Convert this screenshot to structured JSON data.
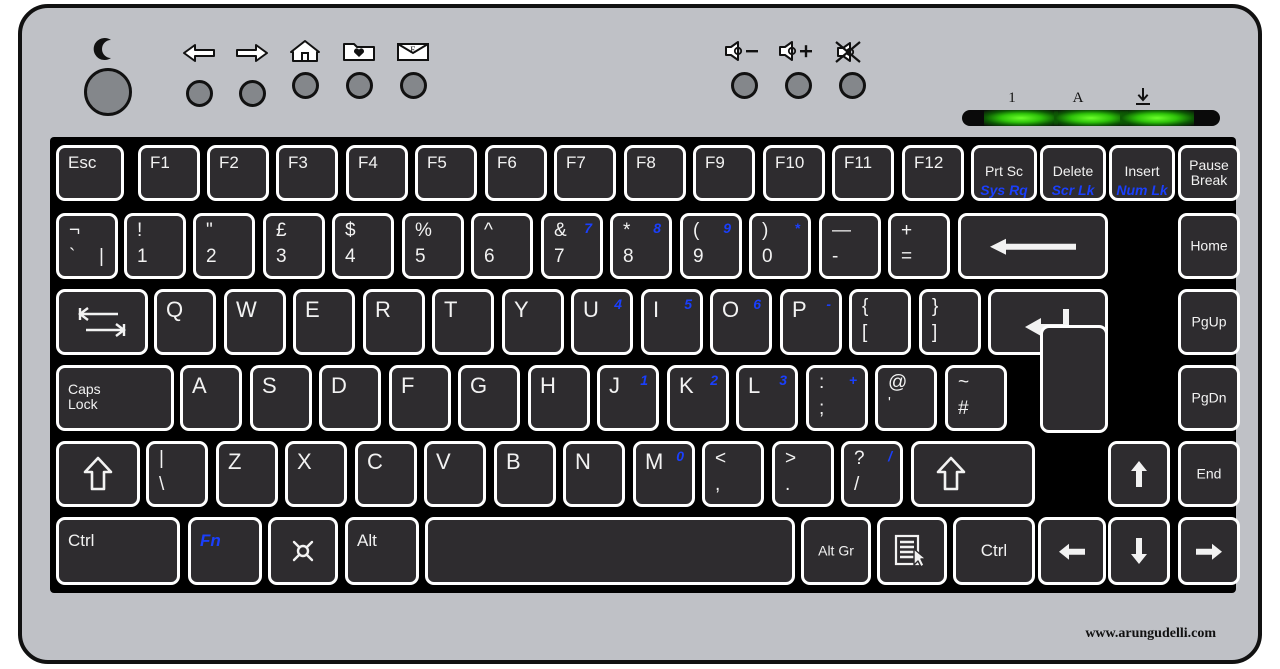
{
  "device": {
    "name": "Computer Keyboard Diagram",
    "layout": "UK QWERTY",
    "body_color": "#bfc1c6",
    "key_color": "#2e2c2f",
    "legend_color": "#f2f2f2",
    "alt_legend_color": "#1a3ffb"
  },
  "watermark": {
    "text": "www.arungudelli.com"
  },
  "hotkeys": {
    "left": [
      {
        "name": "sleep",
        "glyph": "moon",
        "size": "large"
      }
    ],
    "media": [
      {
        "name": "back",
        "glyph": "arrow-left"
      },
      {
        "name": "forward",
        "glyph": "arrow-right"
      },
      {
        "name": "home",
        "glyph": "house"
      },
      {
        "name": "favorites",
        "glyph": "folder-heart"
      },
      {
        "name": "email",
        "glyph": "envelope-e"
      }
    ],
    "volume": [
      {
        "name": "volume-down",
        "glyph": "speaker-minus"
      },
      {
        "name": "volume-up",
        "glyph": "speaker-plus"
      },
      {
        "name": "mute",
        "glyph": "speaker-mute"
      }
    ]
  },
  "indicators": [
    {
      "name": "num-lock",
      "label": "1",
      "lit": true,
      "color": "#2fc40a"
    },
    {
      "name": "caps-lock",
      "label": "A",
      "lit": true,
      "color": "#2fc40a"
    },
    {
      "name": "scroll-lock",
      "label": "scroll-lock-glyph",
      "lit": true,
      "color": "#2fc40a"
    }
  ],
  "rows": {
    "function": [
      {
        "name": "escape",
        "label": "Esc"
      },
      {
        "name": "f1",
        "label": "F1"
      },
      {
        "name": "f2",
        "label": "F2"
      },
      {
        "name": "f3",
        "label": "F3"
      },
      {
        "name": "f4",
        "label": "F4"
      },
      {
        "name": "f5",
        "label": "F5"
      },
      {
        "name": "f6",
        "label": "F6"
      },
      {
        "name": "f7",
        "label": "F7"
      },
      {
        "name": "f8",
        "label": "F8"
      },
      {
        "name": "f9",
        "label": "F9"
      },
      {
        "name": "f10",
        "label": "F10"
      },
      {
        "name": "f11",
        "label": "F11"
      },
      {
        "name": "f12",
        "label": "F12"
      },
      {
        "name": "print-screen",
        "label": "Prt Sc",
        "alt": "Sys Rq"
      },
      {
        "name": "delete",
        "label": "Delete",
        "alt": "Scr Lk"
      },
      {
        "name": "insert",
        "label": "Insert",
        "alt": "Num Lk"
      },
      {
        "name": "pause-break",
        "label": "Pause\nBreak"
      }
    ],
    "number": [
      {
        "name": "backtick",
        "top": "¬",
        "bottom": "`",
        "extra": "|"
      },
      {
        "name": "digit-1",
        "top": "!",
        "bottom": "1"
      },
      {
        "name": "digit-2",
        "top": "\"",
        "bottom": "2"
      },
      {
        "name": "digit-3",
        "top": "£",
        "bottom": "3"
      },
      {
        "name": "digit-4",
        "top": "$",
        "bottom": "4"
      },
      {
        "name": "digit-5",
        "top": "%",
        "bottom": "5"
      },
      {
        "name": "digit-6",
        "top": "^",
        "bottom": "6"
      },
      {
        "name": "digit-7",
        "top": "&",
        "bottom": "7",
        "alt": "7"
      },
      {
        "name": "digit-8",
        "top": "*",
        "bottom": "8",
        "alt": "8"
      },
      {
        "name": "digit-9",
        "top": "(",
        "bottom": "9",
        "alt": "9"
      },
      {
        "name": "digit-0",
        "top": ")",
        "bottom": "0",
        "alt": "*"
      },
      {
        "name": "minus",
        "top": "—",
        "bottom": "-"
      },
      {
        "name": "equals",
        "top": "+",
        "bottom": "="
      },
      {
        "name": "backspace",
        "label": "backspace-arrow"
      },
      {
        "name": "home",
        "label": "Home"
      }
    ],
    "top_letters": [
      {
        "name": "tab",
        "label": "tab-arrows"
      },
      {
        "name": "q",
        "label": "Q"
      },
      {
        "name": "w",
        "label": "W"
      },
      {
        "name": "e",
        "label": "E"
      },
      {
        "name": "r",
        "label": "R"
      },
      {
        "name": "t",
        "label": "T"
      },
      {
        "name": "y",
        "label": "Y"
      },
      {
        "name": "u",
        "label": "U",
        "alt": "4"
      },
      {
        "name": "i",
        "label": "I",
        "alt": "5"
      },
      {
        "name": "o",
        "label": "O",
        "alt": "6"
      },
      {
        "name": "p",
        "label": "P",
        "alt": "-"
      },
      {
        "name": "bracket-left",
        "top": "{",
        "bottom": "["
      },
      {
        "name": "bracket-right",
        "top": "}",
        "bottom": "]"
      },
      {
        "name": "enter",
        "label": "enter-arrow"
      },
      {
        "name": "page-up",
        "label": "PgUp"
      }
    ],
    "home_letters": [
      {
        "name": "caps-lock",
        "label": "Caps\nLock"
      },
      {
        "name": "a",
        "label": "A"
      },
      {
        "name": "s",
        "label": "S"
      },
      {
        "name": "d",
        "label": "D"
      },
      {
        "name": "f",
        "label": "F"
      },
      {
        "name": "g",
        "label": "G"
      },
      {
        "name": "h",
        "label": "H"
      },
      {
        "name": "j",
        "label": "J",
        "alt": "1"
      },
      {
        "name": "k",
        "label": "K",
        "alt": "2"
      },
      {
        "name": "l",
        "label": "L",
        "alt": "3"
      },
      {
        "name": "semicolon",
        "top": ":",
        "bottom": ";",
        "alt": "+"
      },
      {
        "name": "apostrophe",
        "top": "@",
        "bottom": "'"
      },
      {
        "name": "hash",
        "top": "~",
        "bottom": "#"
      },
      {
        "name": "page-down",
        "label": "PgDn"
      }
    ],
    "bottom_letters": [
      {
        "name": "shift-left",
        "label": "shift-arrow"
      },
      {
        "name": "backslash",
        "top": "|",
        "bottom": "\\"
      },
      {
        "name": "z",
        "label": "Z"
      },
      {
        "name": "x",
        "label": "X"
      },
      {
        "name": "c",
        "label": "C"
      },
      {
        "name": "v",
        "label": "V"
      },
      {
        "name": "b",
        "label": "B"
      },
      {
        "name": "n",
        "label": "N"
      },
      {
        "name": "m",
        "label": "M",
        "alt": "0"
      },
      {
        "name": "comma",
        "top": "<",
        "bottom": ","
      },
      {
        "name": "period",
        "top": ">",
        "bottom": "."
      },
      {
        "name": "slash",
        "top": "?",
        "bottom": "/",
        "alt": "/"
      },
      {
        "name": "shift-right",
        "label": "shift-arrow"
      },
      {
        "name": "arrow-up",
        "label": "arrow-up-glyph"
      },
      {
        "name": "end",
        "label": "End"
      }
    ],
    "modifier": [
      {
        "name": "ctrl-left",
        "label": "Ctrl"
      },
      {
        "name": "fn",
        "label": "Fn"
      },
      {
        "name": "windows",
        "label": "windows-glyph"
      },
      {
        "name": "alt-left",
        "label": "Alt"
      },
      {
        "name": "space",
        "label": ""
      },
      {
        "name": "alt-gr",
        "label": "Alt Gr"
      },
      {
        "name": "menu",
        "label": "context-menu-glyph"
      },
      {
        "name": "ctrl-right",
        "label": "Ctrl"
      },
      {
        "name": "arrow-left",
        "label": "arrow-left-glyph"
      },
      {
        "name": "arrow-down",
        "label": "arrow-down-glyph"
      },
      {
        "name": "arrow-right",
        "label": "arrow-right-glyph"
      }
    ]
  }
}
